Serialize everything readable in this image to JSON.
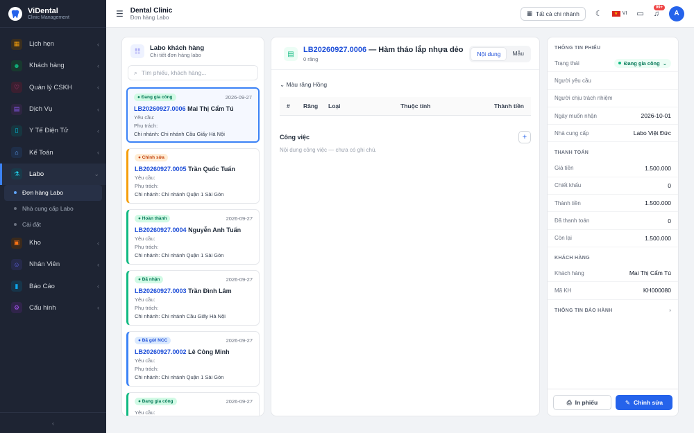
{
  "app": {
    "name": "ViDental",
    "tagline": "Clinic Management"
  },
  "menu": [
    {
      "label": "Lịch hẹn",
      "icon": "calendar-icon",
      "color": "#f59e0b"
    },
    {
      "label": "Khách hàng",
      "icon": "users-icon",
      "color": "#10b981"
    },
    {
      "label": "Quản lý CSKH",
      "icon": "heart-icon",
      "color": "#ec4899"
    },
    {
      "label": "Dịch Vụ",
      "icon": "service-icon",
      "color": "#8b5cf6"
    },
    {
      "label": "Y Tế Điện Tử",
      "icon": "medical-file-icon",
      "color": "#06b6d4"
    },
    {
      "label": "Kế Toán",
      "icon": "bank-icon",
      "color": "#60a5fa"
    },
    {
      "label": "Labo",
      "icon": "flask-icon",
      "color": "#22d3ee"
    },
    {
      "label": "Kho",
      "icon": "warehouse-icon",
      "color": "#f97316"
    },
    {
      "label": "Nhân Viên",
      "icon": "staff-icon",
      "color": "#6366f1"
    },
    {
      "label": "Báo Cáo",
      "icon": "chart-icon",
      "color": "#0ea5e9"
    },
    {
      "label": "Cấu hình",
      "icon": "settings-icon",
      "color": "#a855f7"
    }
  ],
  "submenu": [
    "Đơn hàng Labo",
    "Nhà cung cấp Labo",
    "Cài đặt"
  ],
  "topbar": {
    "title": "Dental Clinic",
    "subtitle": "Đơn hàng Labo",
    "branch": "Tất cả chi nhánh",
    "lang": "VI",
    "notif": "99+",
    "avatar": "A"
  },
  "list": {
    "title": "Labo khách hàng",
    "subtitle": "Chi tiết đơn hàng labo",
    "search_placeholder": "Tìm phiếu, khách hàng...",
    "lbl_req": "Yêu cầu:",
    "lbl_resp": "Phụ trách:",
    "lbl_branch": "Chi nhánh:",
    "orders": [
      {
        "status": "Đang gia công",
        "date": "2026-09-27",
        "code": "LB20260927.0006",
        "name": "Mai Thị Cẩm Tú",
        "branch": "Chi nhánh Cầu Giấy Hà Nội",
        "color": "#047857",
        "bg": "#d1fae5",
        "bar": "#3b82f6"
      },
      {
        "status": "Chỉnh sửa",
        "date": "",
        "code": "LB20260927.0005",
        "name": "Trần Quốc Tuấn",
        "branch": "Chi nhánh Quận 1 Sài Gòn",
        "color": "#c2410c",
        "bg": "#ffedd5",
        "bar": "#f59e0b"
      },
      {
        "status": "Hoàn thành",
        "date": "2026-09-27",
        "code": "LB20260927.0004",
        "name": "Nguyễn Anh Tuấn",
        "branch": "Chi nhánh Quận 1 Sài Gòn",
        "color": "#047857",
        "bg": "#d1fae5",
        "bar": "#10b981"
      },
      {
        "status": "Đã nhận",
        "date": "2026-09-27",
        "code": "LB20260927.0003",
        "name": "Trần Đình Lâm",
        "branch": "Chi nhánh Cầu Giấy Hà Nội",
        "color": "#047857",
        "bg": "#d1fae5",
        "bar": "#10b981"
      },
      {
        "status": "Đã gửi NCC",
        "date": "2026-09-27",
        "code": "LB20260927.0002",
        "name": "Lê Công Minh",
        "branch": "Chi nhánh Quận 1 Sài Gòn",
        "color": "#1d4ed8",
        "bg": "#dbeafe",
        "bar": "#3b82f6"
      },
      {
        "status": "Đang gia công",
        "date": "2026-09-27",
        "code": "",
        "name": "",
        "branch": "",
        "color": "#047857",
        "bg": "#d1fae5",
        "bar": "#10b981"
      }
    ]
  },
  "detail": {
    "code": "LB20260927.0006",
    "title": "— Hàm tháo lắp nhựa dẻo",
    "teeth_count": "0 răng",
    "tab_content": "Nội dung",
    "tab_template": "Mẫu",
    "shade": "Màu răng Hồng",
    "cols": [
      "#",
      "Răng",
      "Loại",
      "Thuộc tính",
      "Thành tiền"
    ],
    "work_title": "Công việc",
    "work_empty": "Nội dung công việc — chưa có ghi chú."
  },
  "info": {
    "group1": "THÔNG TIN PHIẾU",
    "status_label": "Trạng thái",
    "status_value": "Đang gia công",
    "requester_label": "Người yêu cầu",
    "responsible_label": "Người chịu trách nhiệm",
    "wanted_label": "Ngày muốn nhận",
    "wanted_value": "2026-10-01",
    "supplier_label": "Nhà cung cấp",
    "supplier_value": "Labo Việt Đức",
    "group2": "THANH TOÁN",
    "price_label": "Giá tiền",
    "price_value": "1.500.000",
    "discount_label": "Chiết khấu",
    "discount_value": "0",
    "total_label": "Thành tiền",
    "total_value": "1.500.000",
    "paid_label": "Đã thanh toán",
    "paid_value": "0",
    "remain_label": "Còn lại",
    "remain_value": "1.500.000",
    "group3": "KHÁCH HÀNG",
    "customer_label": "Khách hàng",
    "customer_value": "Mai Thị Cẩm Tú",
    "cid_label": "Mã KH",
    "cid_value": "KH000080",
    "group4": "THÔNG TIN BẢO HÀNH",
    "print": "In phiếu",
    "edit": "Chỉnh sửa"
  }
}
